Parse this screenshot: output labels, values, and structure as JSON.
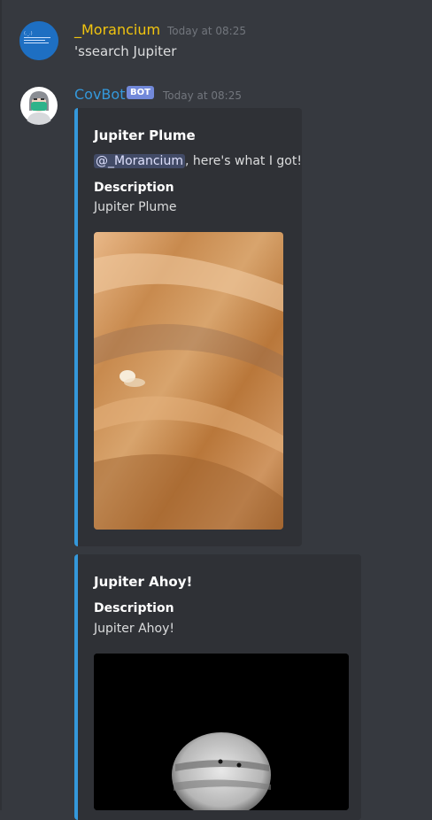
{
  "messages": [
    {
      "username": "_Morancium",
      "username_color": "#f1c40f",
      "timestamp": "Today at 08:25",
      "content": "'ssearch Jupiter"
    },
    {
      "username": "CovBot",
      "username_color": "#3498db",
      "bot_tag": "BOT",
      "timestamp": "Today at 08:25",
      "embeds": [
        {
          "title": "Jupiter Plume",
          "mention": "@_Morancium",
          "description_suffix": ", here's what I got!",
          "field_name": "Description",
          "field_value": "Jupiter Plume",
          "image_alt": "Jupiter cloud bands with a white plume"
        },
        {
          "title": "Jupiter Ahoy!",
          "field_name": "Description",
          "field_value": "Jupiter Ahoy!",
          "image_alt": "Grayscale Jupiter on black background"
        }
      ]
    }
  ],
  "colors": {
    "background": "#36393f",
    "embed_background": "#2f3136",
    "embed_accent": "#3498db",
    "bot_tag": "#7289da"
  }
}
